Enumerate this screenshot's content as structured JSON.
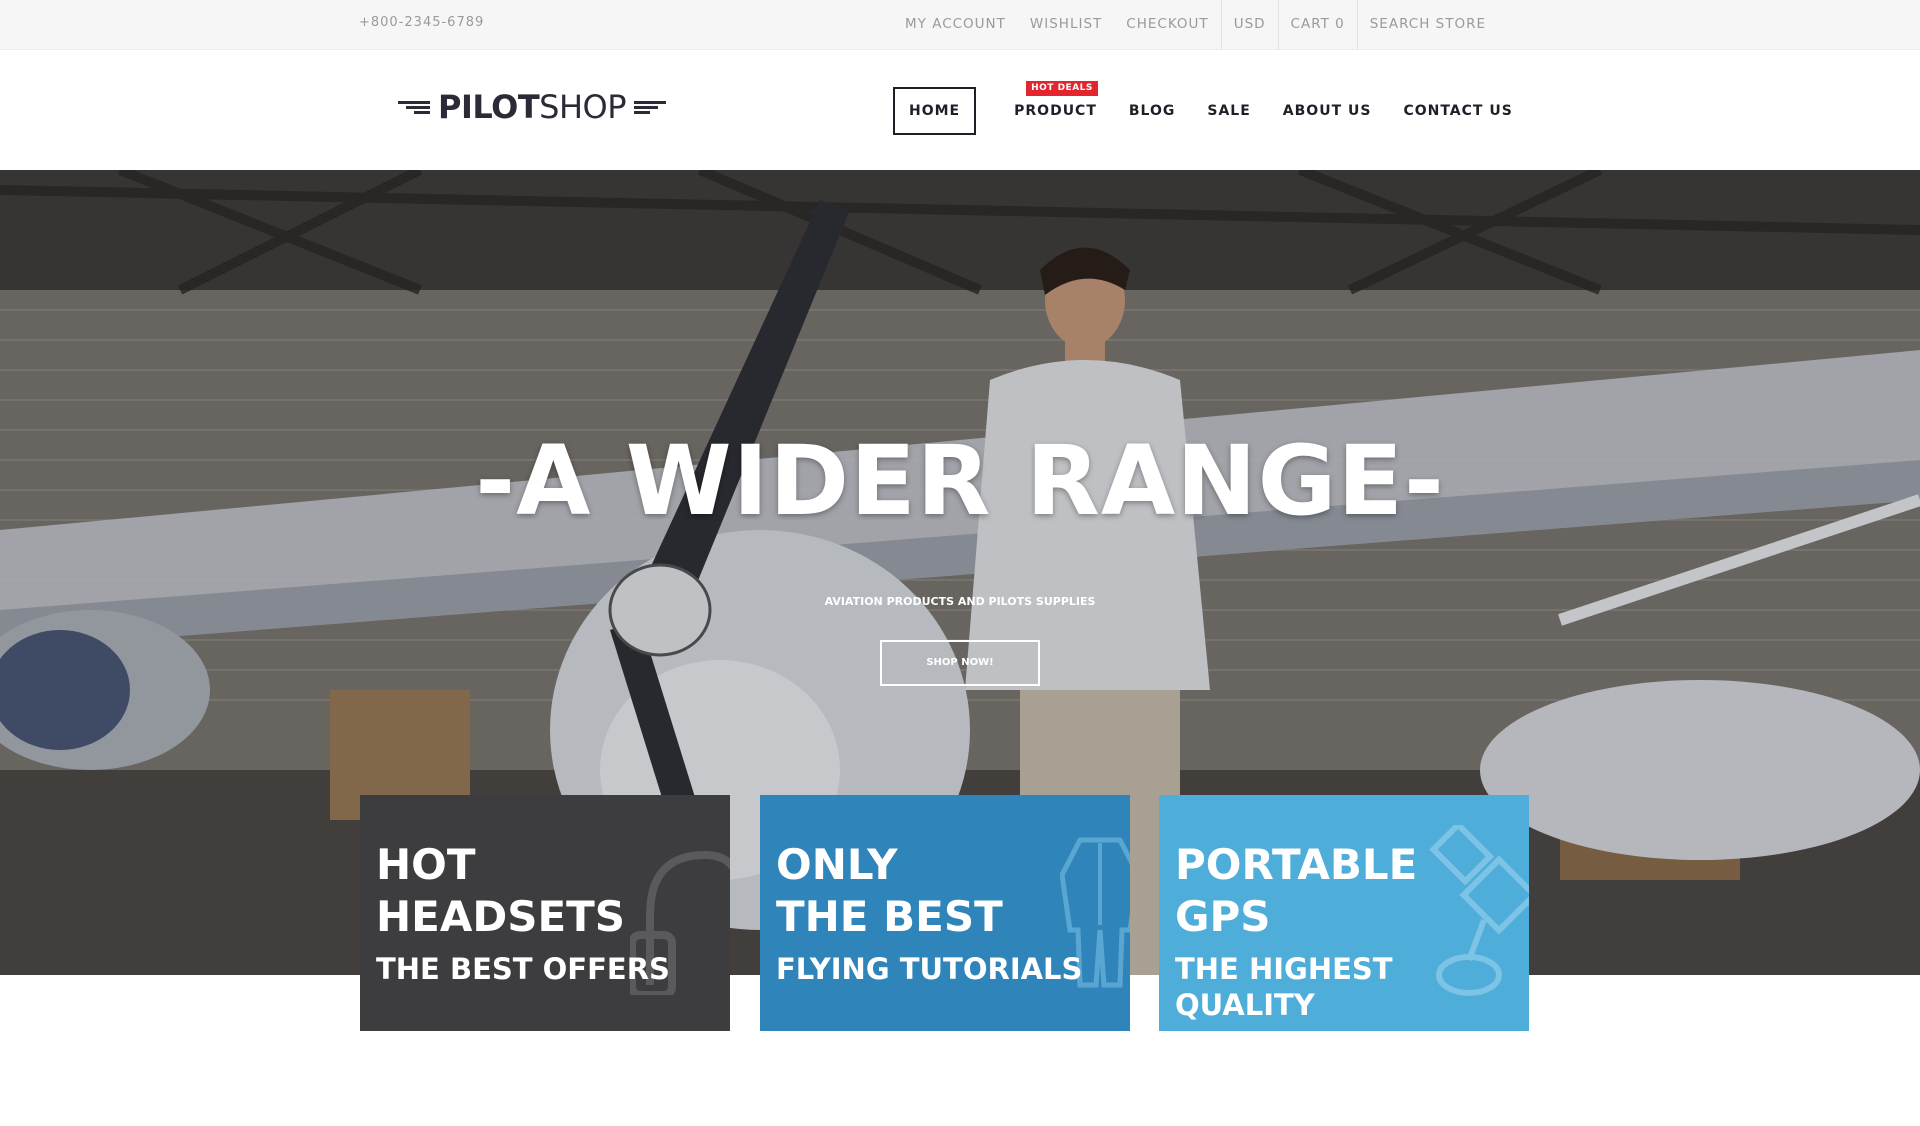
{
  "topbar": {
    "phone": "+800-2345-6789",
    "links": [
      "MY ACCOUNT",
      "WISHLIST",
      "CHECKOUT",
      "USD",
      "CART 0",
      "SEARCH STORE"
    ]
  },
  "logo": {
    "bold": "PILOT",
    "light": "SHOP"
  },
  "nav": {
    "items": [
      "HOME",
      "PRODUCT",
      "BLOG",
      "SALE",
      "ABOUT US",
      "CONTACT US"
    ],
    "badge": "HOT DEALS"
  },
  "hero": {
    "headline": "-A WIDER RANGE-",
    "subline": "AVIATION PRODUCTS AND PILOTS SUPPLIES",
    "button": "SHOP NOW!"
  },
  "features": [
    {
      "line1": "HOT",
      "line2": "HEADSETS",
      "line3": "THE BEST OFFERS",
      "icon": "headset-icon",
      "color": "#3d3d3f"
    },
    {
      "line1": "ONLY",
      "line2": "THE BEST",
      "line3": "FLYING TUTORIALS",
      "icon": "flight-suit-icon",
      "color": "#2f85ba"
    },
    {
      "line1": "PORTABLE",
      "line2": "GPS",
      "line3": "THE HIGHEST QUALITY",
      "icon": "satellite-icon",
      "color": "#4fadd9"
    }
  ],
  "colors": {
    "accent_red": "#e3262d",
    "dark": "#1f1f2a"
  }
}
